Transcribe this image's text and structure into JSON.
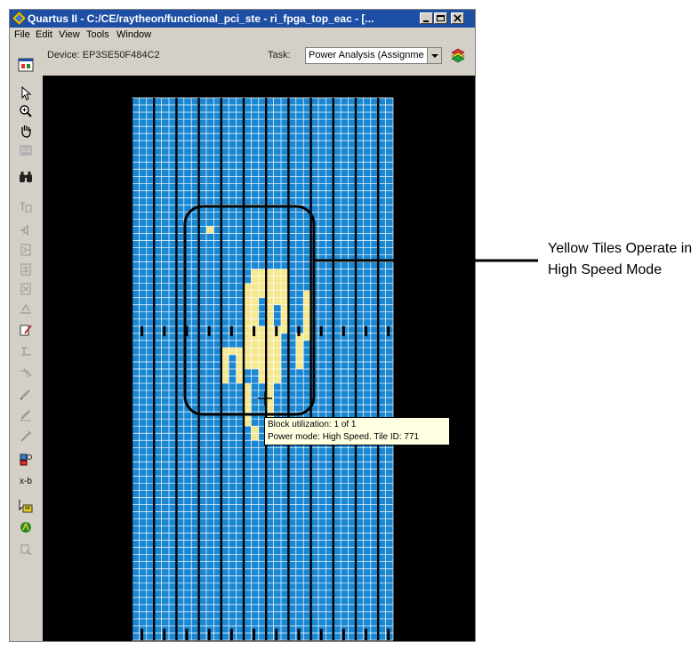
{
  "window": {
    "title": "Quartus II - C:/CE/raytheon/functional_pci_ste - ri_fpga_top_eac - [..."
  },
  "menu": [
    "File",
    "Edit",
    "View",
    "Tools",
    "Window"
  ],
  "toolbar": {
    "device_label": "Device: EP3SE50F484C2",
    "task_label": "Task:",
    "task_value": "Power Analysis (Assignme"
  },
  "side_tools": [
    "floorplan-view-icon",
    "selection-arrow-icon",
    "zoom-icon",
    "hand-pan-icon",
    "fit-view-icon",
    "find-binoculars-icon",
    "assignment-icon",
    "node-icon",
    "fanin-icon",
    "fanout-icon",
    "path-icon",
    "routing-icon",
    "edit-icon",
    "delay-icon",
    "critical-path-icon",
    "pencil-icon",
    "pencil-alt-icon",
    "wand-icon",
    "resource-icon",
    "xb-icon",
    "chip-icon",
    "run-icon",
    "locate-icon"
  ],
  "side_text": {
    "xb_label": "x-b"
  },
  "callout": {
    "line1": "Yellow Tiles Operate in",
    "line2": "High Speed Mode"
  },
  "tooltip": {
    "line1": "Block utilization: 1 of 1",
    "line2": "Power mode: High Speed. Tile ID: 771"
  },
  "colors": {
    "tile": "#1a87d2",
    "tile_high_speed": "#f5e88e",
    "grid_line": "#ffffff",
    "background": "#000000",
    "titlebar": "#1d4fa5"
  }
}
